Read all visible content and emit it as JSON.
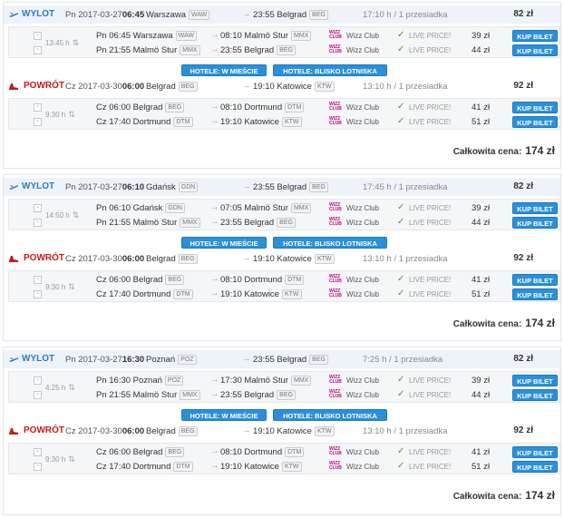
{
  "buy_label": "KUP BILET",
  "live_label": "LIVE PRICE!",
  "hotel_city_label": "HOTELE: W MIEŚCIE",
  "hotel_airport_label": "HOTELE: BLISKO LOTNISKA",
  "total_label": "Całkowita cena:",
  "results": [
    {
      "outbound": {
        "dir": "WYLOT",
        "date": "Pn 2017-03-27",
        "time": "06:45",
        "city": "Warszawa",
        "code": "WAW",
        "arr_time": "23:55",
        "arr_city": "Belgrad",
        "arr_code": "BEG",
        "duration": "17:10 h / 1 przesiadka",
        "price": "82 zł",
        "layover": "13:45 h",
        "legs": [
          {
            "dep": "Pn 06:45 Warszawa",
            "dep_code": "WAW",
            "arr": "08:10 Malmö Stur",
            "arr_code": "MMX",
            "airline": "Wizz Club",
            "price": "39 zł"
          },
          {
            "dep": "Pn 21:55 Malmö Stur",
            "dep_code": "MMX",
            "arr": "23:55 Belgrad",
            "arr_code": "BEG",
            "airline": "Wizz Club",
            "price": "44 zł"
          }
        ]
      },
      "return": {
        "dir": "POWRÓT",
        "date": "Cz 2017-03-30",
        "time": "06:00",
        "city": "Belgrad",
        "code": "BEG",
        "arr_time": "19:10",
        "arr_city": "Katowice",
        "arr_code": "KTW",
        "duration": "13:10 h / 1 przesiadka",
        "price": "92 zł",
        "layover": "9:30 h",
        "legs": [
          {
            "dep": "Cz 06:00 Belgrad",
            "dep_code": "BEG",
            "arr": "08:10 Dortmund",
            "arr_code": "DTM",
            "airline": "Wizz Club",
            "price": "41 zł"
          },
          {
            "dep": "Cz 17:40 Dortmund",
            "dep_code": "DTM",
            "arr": "19:10 Katowice",
            "arr_code": "KTW",
            "airline": "Wizz Club",
            "price": "51 zł"
          }
        ]
      },
      "total": "174 zł"
    },
    {
      "outbound": {
        "dir": "WYLOT",
        "date": "Pn 2017-03-27",
        "time": "06:10",
        "city": "Gdańsk",
        "code": "GDN",
        "arr_time": "23:55",
        "arr_city": "Belgrad",
        "arr_code": "BEG",
        "duration": "17:45 h / 1 przesiadka",
        "price": "82 zł",
        "layover": "14:50 h",
        "legs": [
          {
            "dep": "Pn 06:10 Gdańsk",
            "dep_code": "GDN",
            "arr": "07:05 Malmö Stur",
            "arr_code": "MMX",
            "airline": "Wizz Club",
            "price": "39 zł"
          },
          {
            "dep": "Pn 21:55 Malmö Stur",
            "dep_code": "MMX",
            "arr": "23:55 Belgrad",
            "arr_code": "BEG",
            "airline": "Wizz Club",
            "price": "44 zł"
          }
        ]
      },
      "return": {
        "dir": "POWRÓT",
        "date": "Cz 2017-03-30",
        "time": "06:00",
        "city": "Belgrad",
        "code": "BEG",
        "arr_time": "19:10",
        "arr_city": "Katowice",
        "arr_code": "KTW",
        "duration": "13:10 h / 1 przesiadka",
        "price": "92 zł",
        "layover": "9:30 h",
        "legs": [
          {
            "dep": "Cz 06:00 Belgrad",
            "dep_code": "BEG",
            "arr": "08:10 Dortmund",
            "arr_code": "DTM",
            "airline": "Wizz Club",
            "price": "41 zł"
          },
          {
            "dep": "Cz 17:40 Dortmund",
            "dep_code": "DTM",
            "arr": "19:10 Katowice",
            "arr_code": "KTW",
            "airline": "Wizz Club",
            "price": "51 zł"
          }
        ]
      },
      "total": "174 zł"
    },
    {
      "outbound": {
        "dir": "WYLOT",
        "date": "Pn 2017-03-27",
        "time": "16:30",
        "city": "Poznań",
        "code": "POZ",
        "arr_time": "23:55",
        "arr_city": "Belgrad",
        "arr_code": "BEG",
        "duration": "7:25 h / 1 przesiadka",
        "price": "82 zł",
        "layover": "4:25 h",
        "legs": [
          {
            "dep": "Pn 16:30 Poznań",
            "dep_code": "POZ",
            "arr": "17:30 Malmö Stur",
            "arr_code": "MMX",
            "airline": "Wizz Club",
            "price": "39 zł"
          },
          {
            "dep": "Pn 21:55 Malmö Stur",
            "dep_code": "MMX",
            "arr": "23:55 Belgrad",
            "arr_code": "BEG",
            "airline": "Wizz Club",
            "price": "44 zł"
          }
        ]
      },
      "return": {
        "dir": "POWRÓT",
        "date": "Cz 2017-03-30",
        "time": "06:00",
        "city": "Belgrad",
        "code": "BEG",
        "arr_time": "19:10",
        "arr_city": "Katowice",
        "arr_code": "KTW",
        "duration": "13:10 h / 1 przesiadka",
        "price": "92 zł",
        "layover": "9:30 h",
        "legs": [
          {
            "dep": "Cz 06:00 Belgrad",
            "dep_code": "BEG",
            "arr": "08:10 Dortmund",
            "arr_code": "DTM",
            "airline": "Wizz Club",
            "price": "41 zł"
          },
          {
            "dep": "Cz 17:40 Dortmund",
            "dep_code": "DTM",
            "arr": "19:10 Katowice",
            "arr_code": "KTW",
            "airline": "Wizz Club",
            "price": "51 zł"
          }
        ]
      },
      "total": "174 zł"
    }
  ]
}
